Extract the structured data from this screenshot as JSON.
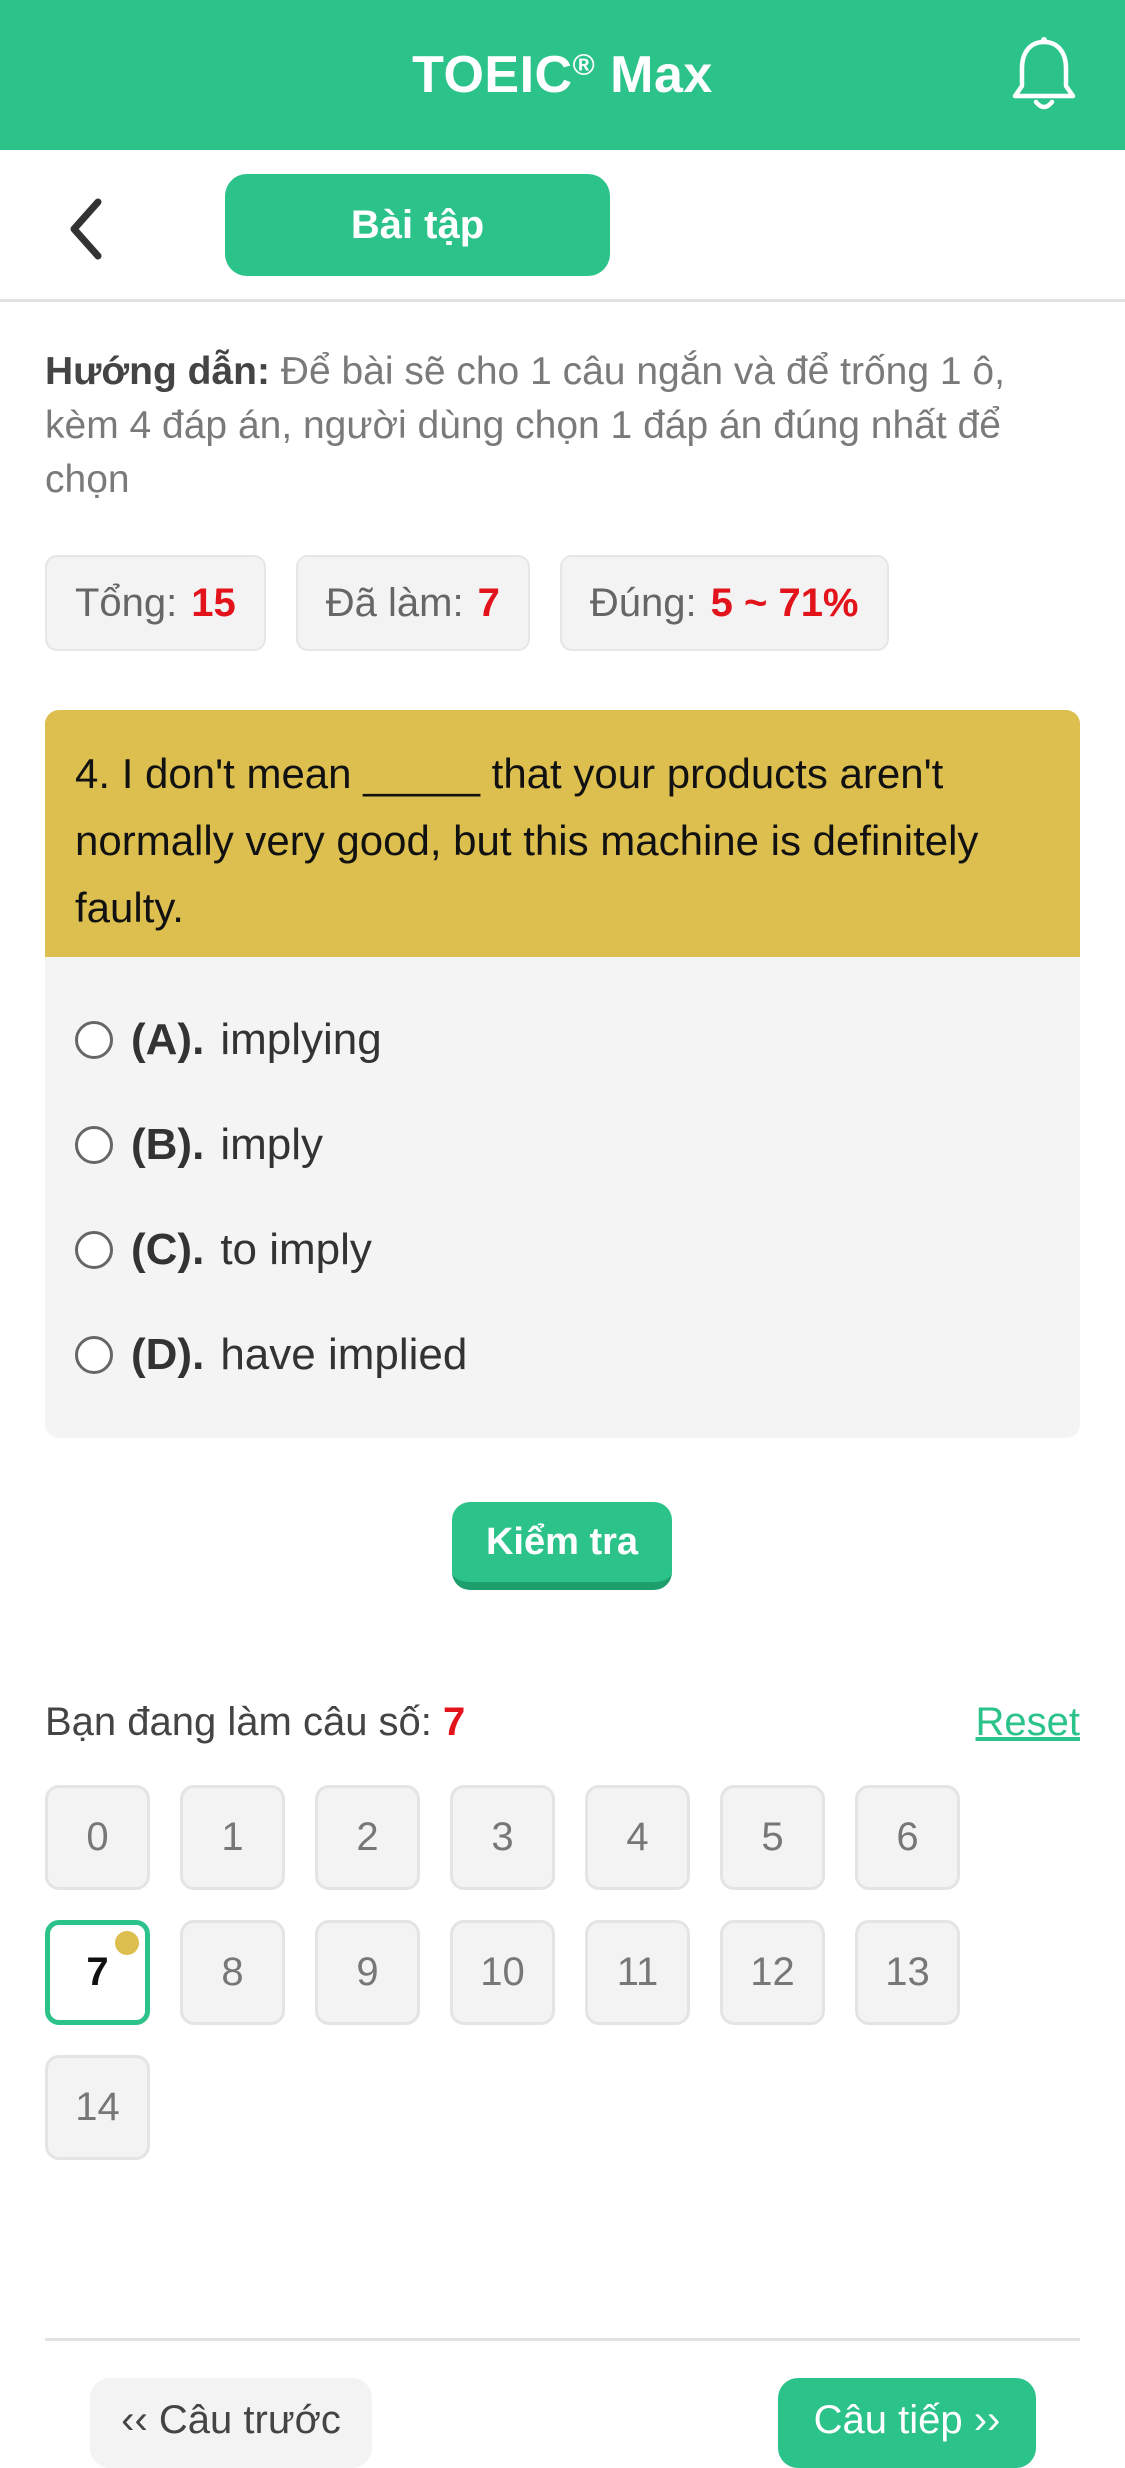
{
  "header": {
    "title": "TOEIC",
    "title_mark": "®",
    "title_suffix": " Max",
    "bell_icon": "bell-icon"
  },
  "subheader": {
    "back_icon": "chevron-left-icon",
    "tab_label": "Bài tập"
  },
  "instructions": {
    "label": "Hướng dẫn:",
    "text": " Để bài sẽ cho 1 câu ngắn và để trống 1 ô, kèm 4 đáp án, người dùng chọn 1 đáp án đúng nhất để chọn"
  },
  "stats": {
    "total_label": "Tổng:",
    "total_value": "15",
    "done_label": "Đã làm:",
    "done_value": "7",
    "correct_label": "Đúng:",
    "correct_value": "5 ~ 71%"
  },
  "question": {
    "text": "4. I don't mean _____ that your products aren't normally very good, but this machine is definitely faulty.",
    "options": [
      {
        "letter": "(A).",
        "text": "implying"
      },
      {
        "letter": "(B).",
        "text": "imply"
      },
      {
        "letter": "(C).",
        "text": "to imply"
      },
      {
        "letter": "(D).",
        "text": "have implied"
      }
    ]
  },
  "check_button_label": "Kiểm tra",
  "progress": {
    "label": "Bạn đang làm câu số: ",
    "current": "7",
    "reset_label": "Reset"
  },
  "numbers": [
    "0",
    "1",
    "2",
    "3",
    "4",
    "5",
    "6",
    "7",
    "8",
    "9",
    "10",
    "11",
    "12",
    "13",
    "14"
  ],
  "current_index": 7,
  "nav": {
    "prev_label": "‹‹ Câu trước",
    "next_label": "Câu tiếp ››"
  },
  "colors": {
    "brand_green": "#2cc38a",
    "question_yellow": "#dcbf4e",
    "highlight_red": "#e3131b"
  }
}
